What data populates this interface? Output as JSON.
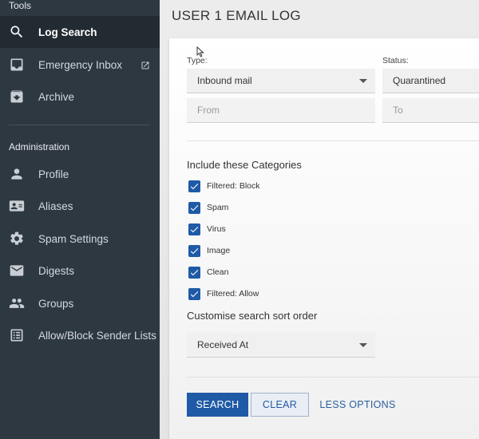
{
  "sidebar": {
    "tools_heading": "Tools",
    "admin_heading": "Administration",
    "tools": [
      {
        "label": "Log Search",
        "icon": "search-icon"
      },
      {
        "label": "Emergency Inbox",
        "icon": "inbox-icon"
      },
      {
        "label": "Archive",
        "icon": "archive-icon"
      }
    ],
    "admin": [
      {
        "label": "Profile",
        "icon": "person-icon"
      },
      {
        "label": "Aliases",
        "icon": "contact-card-icon"
      },
      {
        "label": "Spam Settings",
        "icon": "gear-icon"
      },
      {
        "label": "Digests",
        "icon": "mail-icon"
      },
      {
        "label": "Groups",
        "icon": "group-icon"
      },
      {
        "label": "Allow/Block Sender Lists",
        "icon": "list-icon"
      }
    ]
  },
  "main": {
    "title": "USER 1 EMAIL LOG",
    "type_label": "Type:",
    "type_value": "Inbound mail",
    "status_label": "Status:",
    "status_value": "Quarantined",
    "from_placeholder": "From",
    "to_placeholder": "To",
    "categories_heading": "Include these Categories",
    "categories": [
      {
        "label": "Filtered: Block",
        "checked": true
      },
      {
        "label": "Spam",
        "checked": true
      },
      {
        "label": "Virus",
        "checked": true
      },
      {
        "label": "Image",
        "checked": true
      },
      {
        "label": "Clean",
        "checked": true
      },
      {
        "label": "Filtered: Allow",
        "checked": true
      }
    ],
    "sort_heading": "Customise search sort order",
    "sort_value": "Received At",
    "search_button": "SEARCH",
    "clear_button": "CLEAR",
    "less_options": "LESS OPTIONS"
  },
  "colors": {
    "sidebar_bg": "#2e3841",
    "accent": "#1f5aa6"
  }
}
